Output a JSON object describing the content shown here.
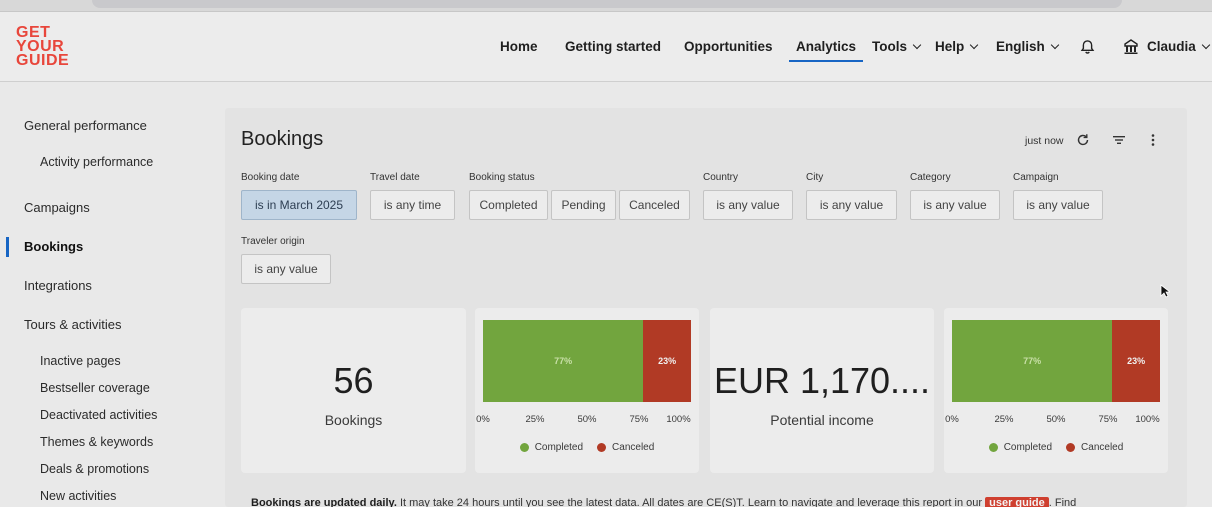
{
  "logo": {
    "line1": "GET",
    "line2": "YOUR",
    "line3": "GUIDE"
  },
  "nav": {
    "home": "Home",
    "getting_started": "Getting started",
    "opportunities": "Opportunities",
    "analytics": "Analytics",
    "tools": "Tools",
    "help": "Help",
    "language": "English",
    "user": "Claudia"
  },
  "sidebar": {
    "general_performance": "General performance",
    "activity_performance": "Activity performance",
    "campaigns": "Campaigns",
    "bookings": "Bookings",
    "integrations": "Integrations",
    "tours_activities": "Tours & activities",
    "inactive_pages": "Inactive pages",
    "bestseller_coverage": "Bestseller coverage",
    "deactivated_activities": "Deactivated activities",
    "themes_keywords": "Themes & keywords",
    "deals_promotions": "Deals & promotions",
    "new_activities": "New activities"
  },
  "page": {
    "title": "Bookings",
    "updated": "just now"
  },
  "filters": {
    "booking_date": {
      "label": "Booking date",
      "value": "is in March 2025"
    },
    "travel_date": {
      "label": "Travel date",
      "value": "is any time"
    },
    "booking_status": {
      "label": "Booking status",
      "completed": "Completed",
      "pending": "Pending",
      "canceled": "Canceled"
    },
    "country": {
      "label": "Country",
      "value": "is any value"
    },
    "city": {
      "label": "City",
      "value": "is any value"
    },
    "category": {
      "label": "Category",
      "value": "is any value"
    },
    "campaign": {
      "label": "Campaign",
      "value": "is any value"
    },
    "traveler_origin": {
      "label": "Traveler origin",
      "value": "is any value"
    }
  },
  "kpis": {
    "bookings_value": "56",
    "bookings_label": "Bookings",
    "income_value": "EUR 1,170....",
    "income_label": "Potential income"
  },
  "bar1": {
    "completed_pct": 77,
    "canceled_pct": 23,
    "completed_label": "77%",
    "canceled_label": "23%"
  },
  "bar2": {
    "completed_pct": 77,
    "canceled_pct": 23,
    "completed_label": "77%",
    "canceled_label": "23%"
  },
  "axis_ticks": [
    "0%",
    "25%",
    "50%",
    "75%",
    "100%"
  ],
  "legend": {
    "completed": "Completed",
    "canceled": "Canceled"
  },
  "colors": {
    "completed": "#72a53e",
    "canceled": "#b13a25",
    "accent": "#1765c4",
    "brand": "#e8463b"
  },
  "footnote": {
    "bold": "Bookings are updated daily.",
    "text": " It may take 24 hours until you see the latest data. All dates are CE(S)T. Learn to navigate and leverage this report in our ",
    "guide": "user guide",
    "tail": ". Find"
  }
}
